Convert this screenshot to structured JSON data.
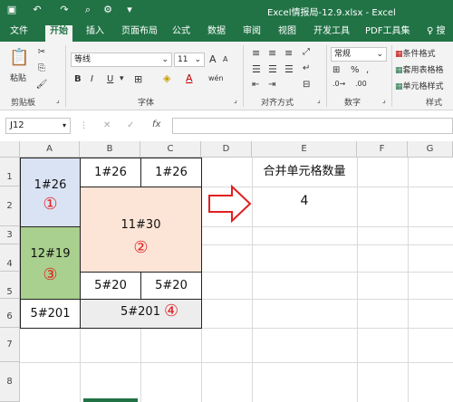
{
  "titlebar": {
    "title": "Excel情报局-12.9.xlsx  -  Excel",
    "qa_save_icon": "save-icon",
    "qa_undo_icon": "undo-icon",
    "qa_redo_icon": "redo-icon"
  },
  "tabs": [
    "文件",
    "开始",
    "插入",
    "页面布局",
    "公式",
    "数据",
    "审阅",
    "视图",
    "开发工具",
    "PDF工具集",
    "搜"
  ],
  "ribbon": {
    "paste_label": "粘贴",
    "clipboard_group": "剪贴板",
    "font_name": "等线",
    "font_size": "11",
    "grow": "A",
    "shrink": "A",
    "bold": "B",
    "italic": "I",
    "underline": "U",
    "wen": "wén",
    "font_group": "字体",
    "align_group": "对齐方式",
    "number_format": "常规",
    "number_group": "数字",
    "cond_format": "条件格式",
    "table_format": "套用表格格",
    "cell_style": "单元格样式",
    "style_group": "样式"
  },
  "formula_bar": {
    "name_box": "J12",
    "cancel": "✕",
    "enter": "✓",
    "fx": "fx",
    "formula": ""
  },
  "sheet": {
    "columns": [
      "A",
      "B",
      "C",
      "D",
      "E",
      "F",
      "G"
    ],
    "rows": [
      "1",
      "2",
      "3",
      "4",
      "5",
      "6",
      "7",
      "8"
    ],
    "a12": "1#26",
    "a12_circ": "①",
    "b1": "1#26",
    "c1": "1#26",
    "b2_c4": "11#30",
    "b2_circ": "②",
    "a34": "12#19",
    "a34_circ": "③",
    "b5": "5#20",
    "c5": "5#20",
    "a6": "5#201",
    "b6c6": "5#201",
    "b6c6_circ": "④",
    "e1": "合并单元格数量",
    "e2": "4"
  },
  "colors": {
    "excel_green": "#217346",
    "a12_fill": "#dae3f3",
    "b2_fill": "#fce4d6",
    "a34_fill": "#a9d08e",
    "b6_fill": "#ededed",
    "circle_red": "#e02020",
    "arrow_red": "#e02020"
  }
}
